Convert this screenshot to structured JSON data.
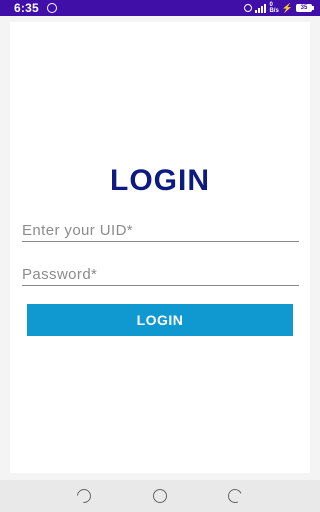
{
  "status_bar": {
    "time": "6:35",
    "network_top": "0",
    "network_bottom": "B/s",
    "battery_level": "35",
    "colors": {
      "background": "#3f0fa8",
      "text": "#ffffff"
    },
    "icons": [
      "app-notification-icon",
      "alarm-icon",
      "signal-icon",
      "charging-icon",
      "battery-icon"
    ]
  },
  "login": {
    "title": "LOGIN",
    "uid_placeholder": "Enter your UID*",
    "uid_value": "",
    "password_placeholder": "Password*",
    "password_value": "",
    "button_label": "LOGIN",
    "colors": {
      "title": "#0d1a80",
      "button": "#0f99d0",
      "button_text": "#ffffff"
    }
  },
  "nav_bar": {
    "icons": [
      "back-icon",
      "home-icon",
      "recents-icon"
    ]
  }
}
